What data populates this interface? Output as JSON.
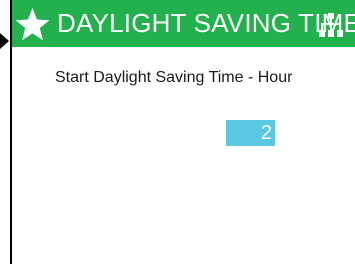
{
  "header": {
    "title": "DAYLIGHT SAVING TIME",
    "left_icon": "star-icon",
    "right_icon": "network-icon",
    "background_color": "#22b14c"
  },
  "setting": {
    "label": "Start Daylight Saving Time - Hour",
    "value": "2",
    "value_highlight_color": "#5ac8e0"
  }
}
